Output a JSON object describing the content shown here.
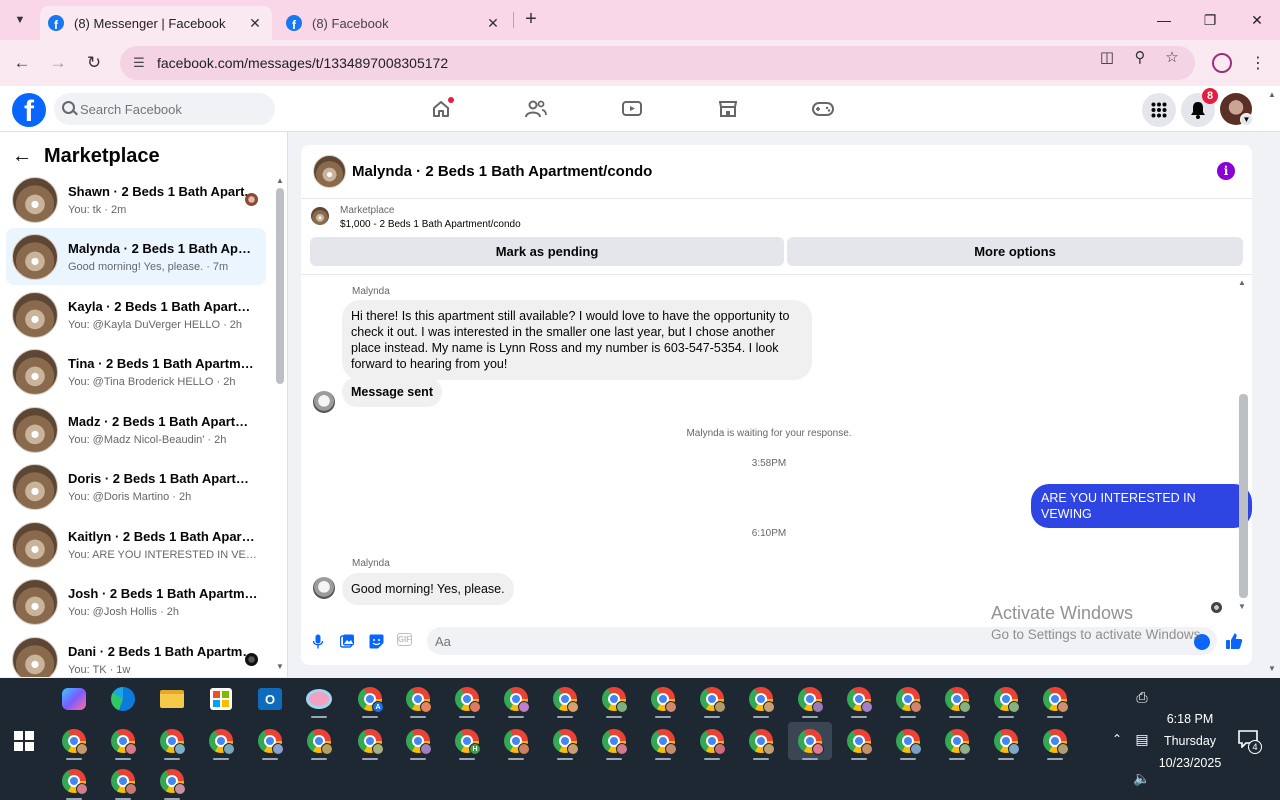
{
  "browser": {
    "tabs": [
      {
        "title": "(8) Messenger | Facebook",
        "active": true
      },
      {
        "title": "(8) Facebook",
        "active": false
      }
    ],
    "url": "facebook.com/messages/t/1334897008305172"
  },
  "facebook": {
    "search_placeholder": "Search Facebook",
    "notification_count": "8",
    "nav_icons": [
      "home-icon",
      "friends-icon",
      "watch-icon",
      "marketplace-icon",
      "gaming-icon"
    ]
  },
  "sidebar": {
    "title": "Marketplace",
    "conversations": [
      {
        "name": "Shawn · 2 Beds 1 Bath Apart...",
        "preview": "You: tk · 2m"
      },
      {
        "name": "Malynda · 2 Beds 1 Bath Apartm...",
        "preview": "Good morning! Yes, please. · 7m"
      },
      {
        "name": "Kayla · 2 Beds 1 Bath Apartment...",
        "preview": "You: @Kayla DuVerger HELLO · 2h"
      },
      {
        "name": "Tina · 2 Beds 1 Bath Apartment/...",
        "preview": "You: @Tina Broderick HELLO · 2h"
      },
      {
        "name": "Madz · 2 Beds 1 Bath Apartmen...",
        "preview": "You: @Madz Nicol-Beaudin' · 2h"
      },
      {
        "name": "Doris · 2 Beds 1 Bath Apartment...",
        "preview": "You: @Doris Martino · 2h"
      },
      {
        "name": "Kaitlyn · 2 Beds 1 Bath Apartme...",
        "preview": "You: ARE YOU INTERESTED IN VE...  · 2h"
      },
      {
        "name": "Josh · 2 Beds 1 Bath Apartment/...",
        "preview": "You: @Josh Hollis · 2h"
      },
      {
        "name": "Dani · 2 Beds 1 Bath Apartme...",
        "preview": "You: TK · 1w"
      }
    ]
  },
  "chat": {
    "title": "Malynda · 2 Beds 1 Bath Apartment/condo",
    "listing_label": "Marketplace",
    "listing_price": "$1,000 - 2 Beds 1 Bath Apartment/condo",
    "buttons": {
      "mark_pending": "Mark as pending",
      "more_options": "More options"
    },
    "messages": {
      "sender_1": "Malynda",
      "first_msg": "Hi there! Is this apartment still available? I would love to have the opportunity to check it out. I was interested in the smaller one last year, but I chose another place instead. My name is Lynn Ross and my number is 603-547-5354.  I look forward to hearing from you!",
      "sent_note": "Message sent",
      "waiting": "Malynda is waiting for your response.",
      "time_1": "3:58PM",
      "outgoing": "ARE YOU INTERESTED IN VEWING",
      "time_2": "6:10PM",
      "sender_2": "Malynda",
      "last_msg": "Good morning! Yes, please."
    },
    "composer_placeholder": "Aa"
  },
  "watermark": {
    "title": "Activate Windows",
    "subtitle": "Go to Settings to activate Windows."
  },
  "taskbar": {
    "time": "6:18 PM",
    "day": "Thursday",
    "date": "10/23/2025",
    "notification_count": "4"
  }
}
